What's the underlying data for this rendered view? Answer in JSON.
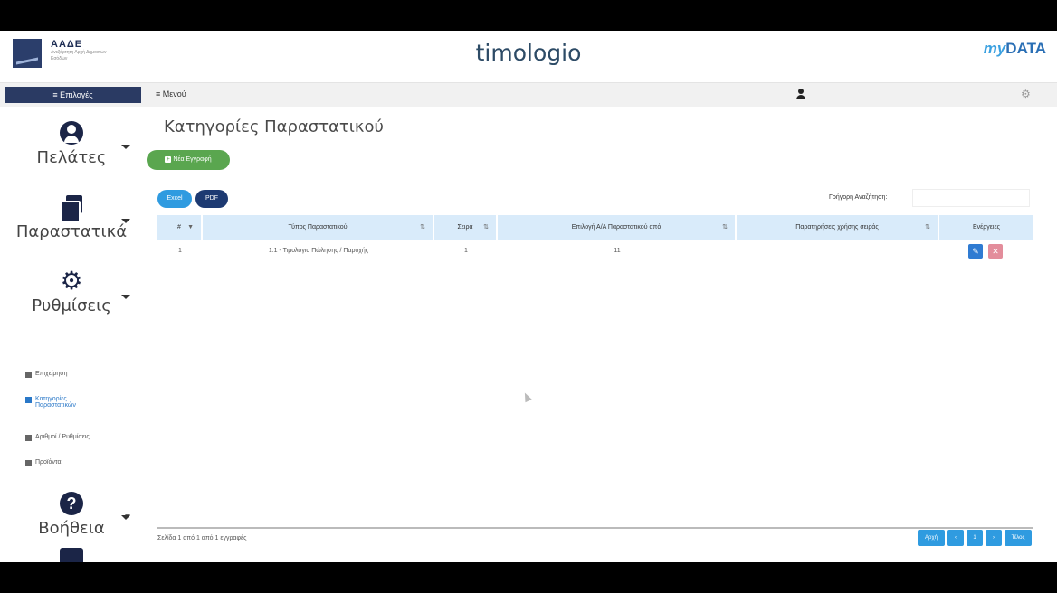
{
  "header": {
    "org_logo_title": "ΑΑΔΕ",
    "org_logo_subtitle": "Ανεξάρτητη Αρχή Δημοσίων Εσόδων",
    "app_title": "timologio",
    "brand_my": "my",
    "brand_data": "DATA"
  },
  "navbar": {
    "options_label": "≡ Επιλογές",
    "menu_label": "≡ Μενού"
  },
  "sidebar": {
    "clients_label": "Πελάτες",
    "documents_label": "Παραστατικά",
    "settings_label": "Ρυθμίσεις",
    "help_label": "Βοήθεια",
    "settings_items": [
      {
        "label": "Επιχείρηση"
      },
      {
        "label": "Κατηγορίες Παραστατικών"
      },
      {
        "label": "Αριθμοί / Ρυθμίσεις"
      },
      {
        "label": "Προϊόντα"
      }
    ]
  },
  "main": {
    "page_title": "Κατηγορίες Παραστατικού",
    "new_button_label": "Νέα Εγγραφή",
    "excel_label": "Excel",
    "pdf_label": "PDF",
    "search_label": "Γρήγορη Αναζήτηση:",
    "table": {
      "headers": [
        "#",
        "Τύπος Παραστατικού",
        "Σειρά",
        "Επιλογή Α/Α Παραστατικού από",
        "Παρατηρήσεις χρήσης σειράς",
        "Ενέργειες"
      ],
      "rows": [
        {
          "num": "1",
          "type": "1.1 - Τιμολόγιο Πώλησης / Παροχής",
          "series": "1",
          "start_from": "11",
          "notes": ""
        }
      ]
    },
    "footer_text": "Σελίδα 1 από 1 από 1 εγγραφές",
    "pager": {
      "first": "Αρχή",
      "prev": "‹",
      "page": "1",
      "next": "›",
      "last": "Τέλος"
    }
  },
  "colors": {
    "primary_dark": "#1b2547",
    "accent_blue": "#2f9be0",
    "success_green": "#5aa64f",
    "header_row": "#d9ebfa"
  }
}
